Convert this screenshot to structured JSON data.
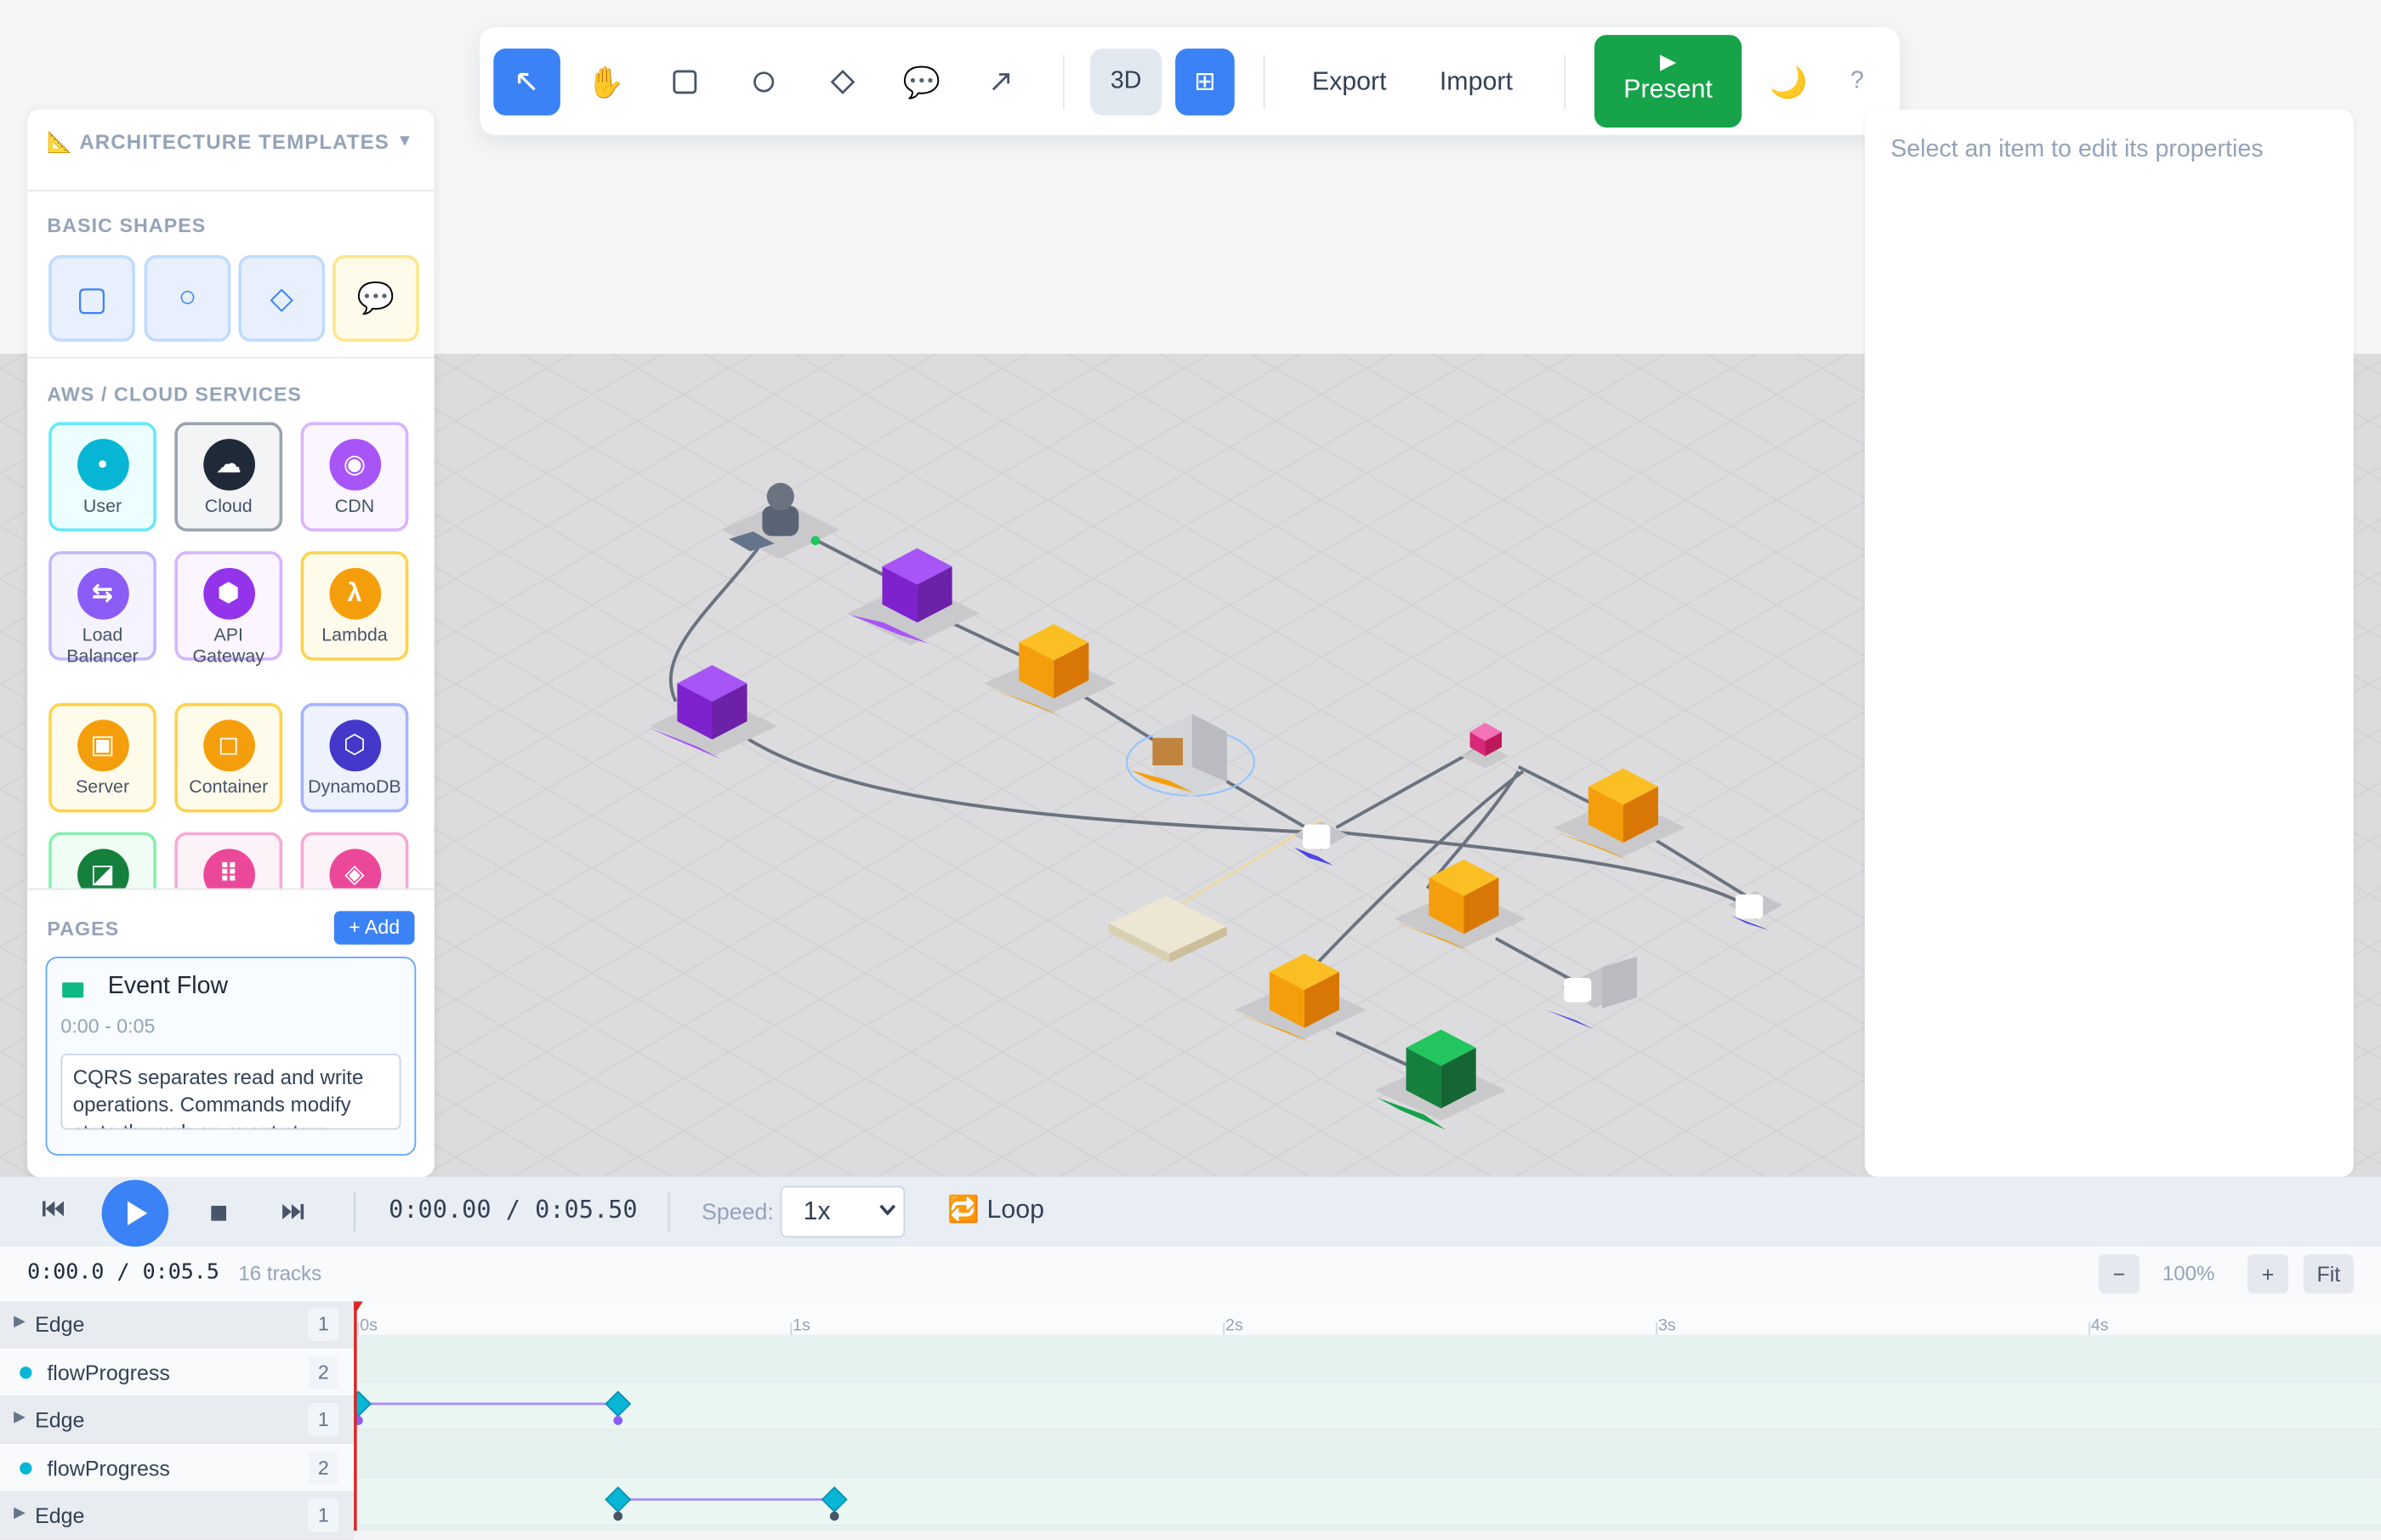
{
  "toolbar": {
    "tools": [
      "select-icon",
      "hand-icon",
      "rectangle-icon",
      "circle-icon",
      "diamond-icon",
      "comment-icon",
      "arrow-icon"
    ],
    "view_3d_label": "3D",
    "grid_label": "⊞",
    "export_label": "Export",
    "import_label": "Import",
    "present_icon": "▶",
    "present_label": "Present",
    "theme_icon": "🌙",
    "help_label": "?"
  },
  "right_panel": {
    "hint": "Select an item to edit its properties"
  },
  "left_panel": {
    "templates_title": "📐 ARCHITECTURE TEMPLATES",
    "templates_chevron": "▼",
    "basic_shapes_title": "BASIC SHAPES",
    "basic_shapes": [
      "▢",
      "○",
      "◇",
      "💬"
    ],
    "cloud_title": "AWS / CLOUD SERVICES",
    "services": [
      {
        "label": "User",
        "icon": "•",
        "color": "#06b6d4",
        "border": "#67e8f9",
        "bg": "#ecfeff"
      },
      {
        "label": "Cloud",
        "icon": "☁",
        "color": "#1f2937",
        "border": "#9ca3af",
        "bg": "#f3f4f6"
      },
      {
        "label": "CDN",
        "icon": "◉",
        "color": "#a855f7",
        "border": "#d8b4fe",
        "bg": "#faf5ff"
      },
      {
        "label": "Load Balancer",
        "icon": "⇆",
        "color": "#8b5cf6",
        "border": "#c4b5fd",
        "bg": "#f5f3ff"
      },
      {
        "label": "API Gateway",
        "icon": "⬢",
        "color": "#9333ea",
        "border": "#d8b4fe",
        "bg": "#faf5ff"
      },
      {
        "label": "Lambda",
        "icon": "λ",
        "color": "#f59e0b",
        "border": "#fcd34d",
        "bg": "#fffbeb"
      },
      {
        "label": "Server",
        "icon": "▣",
        "color": "#f59e0b",
        "border": "#fcd34d",
        "bg": "#fffbeb"
      },
      {
        "label": "Container",
        "icon": "◻",
        "color": "#f59e0b",
        "border": "#fcd34d",
        "bg": "#fffbeb"
      },
      {
        "label": "DynamoDB",
        "icon": "⬡",
        "color": "#4338ca",
        "border": "#a5b4fc",
        "bg": "#eef2ff"
      },
      {
        "label": "",
        "icon": "◪",
        "color": "#15803d",
        "border": "#86efac",
        "bg": "#f0fdf4"
      },
      {
        "label": "",
        "icon": "⠿",
        "color": "#ec4899",
        "border": "#f9a8d4",
        "bg": "#fdf2f8"
      },
      {
        "label": "",
        "icon": "◈",
        "color": "#ec4899",
        "border": "#f9a8d4",
        "bg": "#fdf2f8"
      }
    ],
    "pages_title": "PAGES",
    "add_label": "+ Add",
    "page": {
      "name": "Event Flow",
      "time": "0:00 - 0:05",
      "description": "CQRS separates read and write operations. Commands modify state through an event store"
    }
  },
  "transport": {
    "time": "0:00.00 / 0:05.50",
    "speed_label": "Speed:",
    "speed_value": "1x",
    "loop_label": "🔁 Loop"
  },
  "timeline": {
    "time": "0:00.0 / 0:05.5",
    "tracks_label": "16 tracks",
    "zoom": "100%",
    "zoom_out": "−",
    "zoom_in": "+",
    "fit": "Fit",
    "ticks": [
      "0s",
      "1s",
      "2s",
      "3s",
      "4s"
    ],
    "rows": [
      {
        "kind": "edge",
        "label": "Edge",
        "count": "1"
      },
      {
        "kind": "prop",
        "label": "flowProgress",
        "count": "2"
      },
      {
        "kind": "edge",
        "label": "Edge",
        "count": "1"
      },
      {
        "kind": "prop",
        "label": "flowProgress",
        "count": "2"
      },
      {
        "kind": "edge",
        "label": "Edge",
        "count": "1"
      }
    ],
    "keyframes": [
      {
        "row": 1,
        "times": [
          0.0,
          0.6
        ]
      },
      {
        "row": 3,
        "times": [
          0.6,
          1.1
        ]
      }
    ]
  }
}
